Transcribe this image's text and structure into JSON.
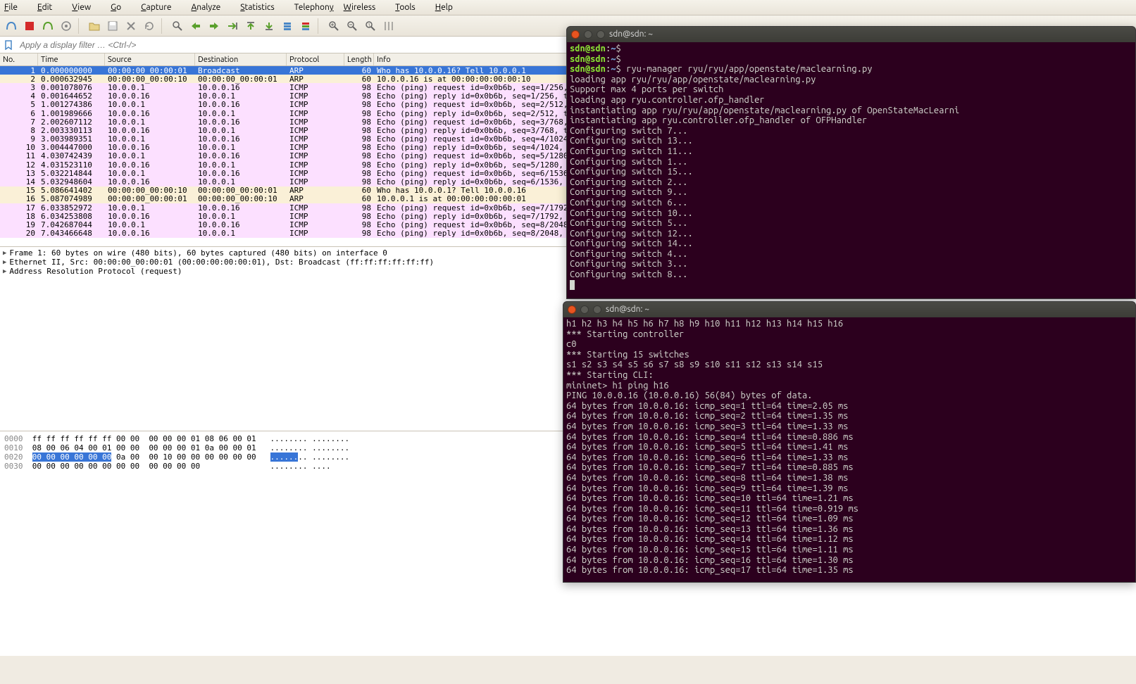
{
  "menu": {
    "file": "File",
    "edit": "Edit",
    "view": "View",
    "go": "Go",
    "capture": "Capture",
    "analyze": "Analyze",
    "statistics": "Statistics",
    "telephony": "Telephony",
    "wireless": "Wireless",
    "tools": "Tools",
    "help": "Help"
  },
  "filter": {
    "placeholder": "Apply a display filter … <Ctrl-/>"
  },
  "columns": {
    "no": "No.",
    "time": "Time",
    "source": "Source",
    "destination": "Destination",
    "protocol": "Protocol",
    "length": "Length",
    "info": "Info"
  },
  "packets": [
    {
      "no": 1,
      "time": "0.000000000",
      "src": "00:00:00_00:00:01",
      "dst": "Broadcast",
      "proto": "ARP",
      "len": 60,
      "info": "Who has 10.0.0.16? Tell 10.0.0.1",
      "cls": "row-sel row-arp"
    },
    {
      "no": 2,
      "time": "0.000632945",
      "src": "00:00:00_00:00:10",
      "dst": "00:00:00_00:00:01",
      "proto": "ARP",
      "len": 60,
      "info": "10.0.0.16 is at 00:00:00:00:00:10",
      "cls": "row-arp"
    },
    {
      "no": 3,
      "time": "0.001078076",
      "src": "10.0.0.1",
      "dst": "10.0.0.16",
      "proto": "ICMP",
      "len": 98,
      "info": "Echo (ping) request  id=0x0b6b, seq=1/256, t",
      "cls": "row-icmp"
    },
    {
      "no": 4,
      "time": "0.001644652",
      "src": "10.0.0.16",
      "dst": "10.0.0.1",
      "proto": "ICMP",
      "len": 98,
      "info": "Echo (ping) reply    id=0x0b6b, seq=1/256, t",
      "cls": "row-icmp"
    },
    {
      "no": 5,
      "time": "1.001274386",
      "src": "10.0.0.1",
      "dst": "10.0.0.16",
      "proto": "ICMP",
      "len": 98,
      "info": "Echo (ping) request  id=0x0b6b, seq=2/512, t",
      "cls": "row-icmp"
    },
    {
      "no": 6,
      "time": "1.001989666",
      "src": "10.0.0.16",
      "dst": "10.0.0.1",
      "proto": "ICMP",
      "len": 98,
      "info": "Echo (ping) reply    id=0x0b6b, seq=2/512, t",
      "cls": "row-icmp"
    },
    {
      "no": 7,
      "time": "2.002607112",
      "src": "10.0.0.1",
      "dst": "10.0.0.16",
      "proto": "ICMP",
      "len": 98,
      "info": "Echo (ping) request  id=0x0b6b, seq=3/768, t",
      "cls": "row-icmp"
    },
    {
      "no": 8,
      "time": "2.003330113",
      "src": "10.0.0.16",
      "dst": "10.0.0.1",
      "proto": "ICMP",
      "len": 98,
      "info": "Echo (ping) reply    id=0x0b6b, seq=3/768, t",
      "cls": "row-icmp"
    },
    {
      "no": 9,
      "time": "3.003989351",
      "src": "10.0.0.1",
      "dst": "10.0.0.16",
      "proto": "ICMP",
      "len": 98,
      "info": "Echo (ping) request  id=0x0b6b, seq=4/1024,",
      "cls": "row-icmp"
    },
    {
      "no": 10,
      "time": "3.004447000",
      "src": "10.0.0.16",
      "dst": "10.0.0.1",
      "proto": "ICMP",
      "len": 98,
      "info": "Echo (ping) reply    id=0x0b6b, seq=4/1024,",
      "cls": "row-icmp"
    },
    {
      "no": 11,
      "time": "4.030742439",
      "src": "10.0.0.1",
      "dst": "10.0.0.16",
      "proto": "ICMP",
      "len": 98,
      "info": "Echo (ping) request  id=0x0b6b, seq=5/1280,",
      "cls": "row-icmp"
    },
    {
      "no": 12,
      "time": "4.031523110",
      "src": "10.0.0.16",
      "dst": "10.0.0.1",
      "proto": "ICMP",
      "len": 98,
      "info": "Echo (ping) reply    id=0x0b6b, seq=5/1280,",
      "cls": "row-icmp"
    },
    {
      "no": 13,
      "time": "5.032214844",
      "src": "10.0.0.1",
      "dst": "10.0.0.16",
      "proto": "ICMP",
      "len": 98,
      "info": "Echo (ping) request  id=0x0b6b, seq=6/1536,",
      "cls": "row-icmp"
    },
    {
      "no": 14,
      "time": "5.032948604",
      "src": "10.0.0.16",
      "dst": "10.0.0.1",
      "proto": "ICMP",
      "len": 98,
      "info": "Echo (ping) reply    id=0x0b6b, seq=6/1536,",
      "cls": "row-icmp"
    },
    {
      "no": 15,
      "time": "5.086641402",
      "src": "00:00:00_00:00:10",
      "dst": "00:00:00_00:00:01",
      "proto": "ARP",
      "len": 60,
      "info": "Who has 10.0.0.1? Tell 10.0.0.16",
      "cls": "row-arp"
    },
    {
      "no": 16,
      "time": "5.087074989",
      "src": "00:00:00_00:00:01",
      "dst": "00:00:00_00:00:10",
      "proto": "ARP",
      "len": 60,
      "info": "10.0.0.1 is at 00:00:00:00:00:01",
      "cls": "row-arp"
    },
    {
      "no": 17,
      "time": "6.033852972",
      "src": "10.0.0.1",
      "dst": "10.0.0.16",
      "proto": "ICMP",
      "len": 98,
      "info": "Echo (ping) request  id=0x0b6b, seq=7/1792,",
      "cls": "row-icmp"
    },
    {
      "no": 18,
      "time": "6.034253808",
      "src": "10.0.0.16",
      "dst": "10.0.0.1",
      "proto": "ICMP",
      "len": 98,
      "info": "Echo (ping) reply    id=0x0b6b, seq=7/1792,",
      "cls": "row-icmp"
    },
    {
      "no": 19,
      "time": "7.042687044",
      "src": "10.0.0.1",
      "dst": "10.0.0.16",
      "proto": "ICMP",
      "len": 98,
      "info": "Echo (ping) request  id=0x0b6b, seq=8/2048,",
      "cls": "row-icmp"
    },
    {
      "no": 20,
      "time": "7.043466648",
      "src": "10.0.0.16",
      "dst": "10.0.0.1",
      "proto": "ICMP",
      "len": 98,
      "info": "Echo (ping) reply    id=0x0b6b, seq=8/2048,",
      "cls": "row-icmp"
    }
  ],
  "details": [
    "Frame 1: 60 bytes on wire (480 bits), 60 bytes captured (480 bits) on interface 0",
    "Ethernet II, Src: 00:00:00_00:00:01 (00:00:00:00:00:01), Dst: Broadcast (ff:ff:ff:ff:ff:ff)",
    "Address Resolution Protocol (request)"
  ],
  "hex": {
    "l0": {
      "off": "0000",
      "b": "ff ff ff ff ff ff 00 00  00 00 00 01 08 06 00 01",
      "a": "........ ........"
    },
    "l1": {
      "off": "0010",
      "b": "08 00 06 04 00 01 00 00  00 00 00 01 0a 00 00 01",
      "a": "........ ........"
    },
    "l2": {
      "off": "0020",
      "b1": "00 00 00 00 00 00",
      "b2": " 0a 00  00 10 00 00 00 00 00 00",
      "a1": "......",
      "a2": ".. ........"
    },
    "l3": {
      "off": "0030",
      "b": "00 00 00 00 00 00 00 00  00 00 00 00            ",
      "a": "........ ....    "
    }
  },
  "term1": {
    "title": "sdn@sdn: ~",
    "lines": [
      {
        "prompt": true,
        "cmd": ""
      },
      {
        "prompt": true,
        "cmd": ""
      },
      {
        "prompt": true,
        "cmd": "ryu-manager ryu/ryu/app/openstate/maclearning.py"
      },
      {
        "text": "loading app ryu/ryu/app/openstate/maclearning.py"
      },
      {
        "text": "Support max 4 ports per switch"
      },
      {
        "text": "loading app ryu.controller.ofp_handler"
      },
      {
        "text": "instantiating app ryu/ryu/app/openstate/maclearning.py of OpenStateMacLearni"
      },
      {
        "text": "instantiating app ryu.controller.ofp_handler of OFPHandler"
      },
      {
        "text": "Configuring switch 7..."
      },
      {
        "text": "Configuring switch 13..."
      },
      {
        "text": "Configuring switch 11..."
      },
      {
        "text": "Configuring switch 1..."
      },
      {
        "text": "Configuring switch 15..."
      },
      {
        "text": "Configuring switch 2..."
      },
      {
        "text": "Configuring switch 9..."
      },
      {
        "text": "Configuring switch 6..."
      },
      {
        "text": "Configuring switch 10..."
      },
      {
        "text": "Configuring switch 5..."
      },
      {
        "text": "Configuring switch 12..."
      },
      {
        "text": "Configuring switch 14..."
      },
      {
        "text": "Configuring switch 4..."
      },
      {
        "text": "Configuring switch 3..."
      },
      {
        "text": "Configuring switch 8..."
      }
    ]
  },
  "term2": {
    "title": "sdn@sdn: ~",
    "lines": [
      "h1 h2 h3 h4 h5 h6 h7 h8 h9 h10 h11 h12 h13 h14 h15 h16",
      "*** Starting controller",
      "c0",
      "*** Starting 15 switches",
      "s1 s2 s3 s4 s5 s6 s7 s8 s9 s10 s11 s12 s13 s14 s15",
      "*** Starting CLI:",
      "mininet> h1 ping h16",
      "PING 10.0.0.16 (10.0.0.16) 56(84) bytes of data.",
      "64 bytes from 10.0.0.16: icmp_seq=1 ttl=64 time=2.05 ms",
      "64 bytes from 10.0.0.16: icmp_seq=2 ttl=64 time=1.35 ms",
      "64 bytes from 10.0.0.16: icmp_seq=3 ttl=64 time=1.33 ms",
      "64 bytes from 10.0.0.16: icmp_seq=4 ttl=64 time=0.886 ms",
      "64 bytes from 10.0.0.16: icmp_seq=5 ttl=64 time=1.41 ms",
      "64 bytes from 10.0.0.16: icmp_seq=6 ttl=64 time=1.33 ms",
      "64 bytes from 10.0.0.16: icmp_seq=7 ttl=64 time=0.885 ms",
      "64 bytes from 10.0.0.16: icmp_seq=8 ttl=64 time=1.38 ms",
      "64 bytes from 10.0.0.16: icmp_seq=9 ttl=64 time=1.39 ms",
      "64 bytes from 10.0.0.16: icmp_seq=10 ttl=64 time=1.21 ms",
      "64 bytes from 10.0.0.16: icmp_seq=11 ttl=64 time=0.919 ms",
      "64 bytes from 10.0.0.16: icmp_seq=12 ttl=64 time=1.09 ms",
      "64 bytes from 10.0.0.16: icmp_seq=13 ttl=64 time=1.36 ms",
      "64 bytes from 10.0.0.16: icmp_seq=14 ttl=64 time=1.12 ms",
      "64 bytes from 10.0.0.16: icmp_seq=15 ttl=64 time=1.11 ms",
      "64 bytes from 10.0.0.16: icmp_seq=16 ttl=64 time=1.30 ms",
      "64 bytes from 10.0.0.16: icmp_seq=17 ttl=64 time=1.35 ms"
    ]
  }
}
